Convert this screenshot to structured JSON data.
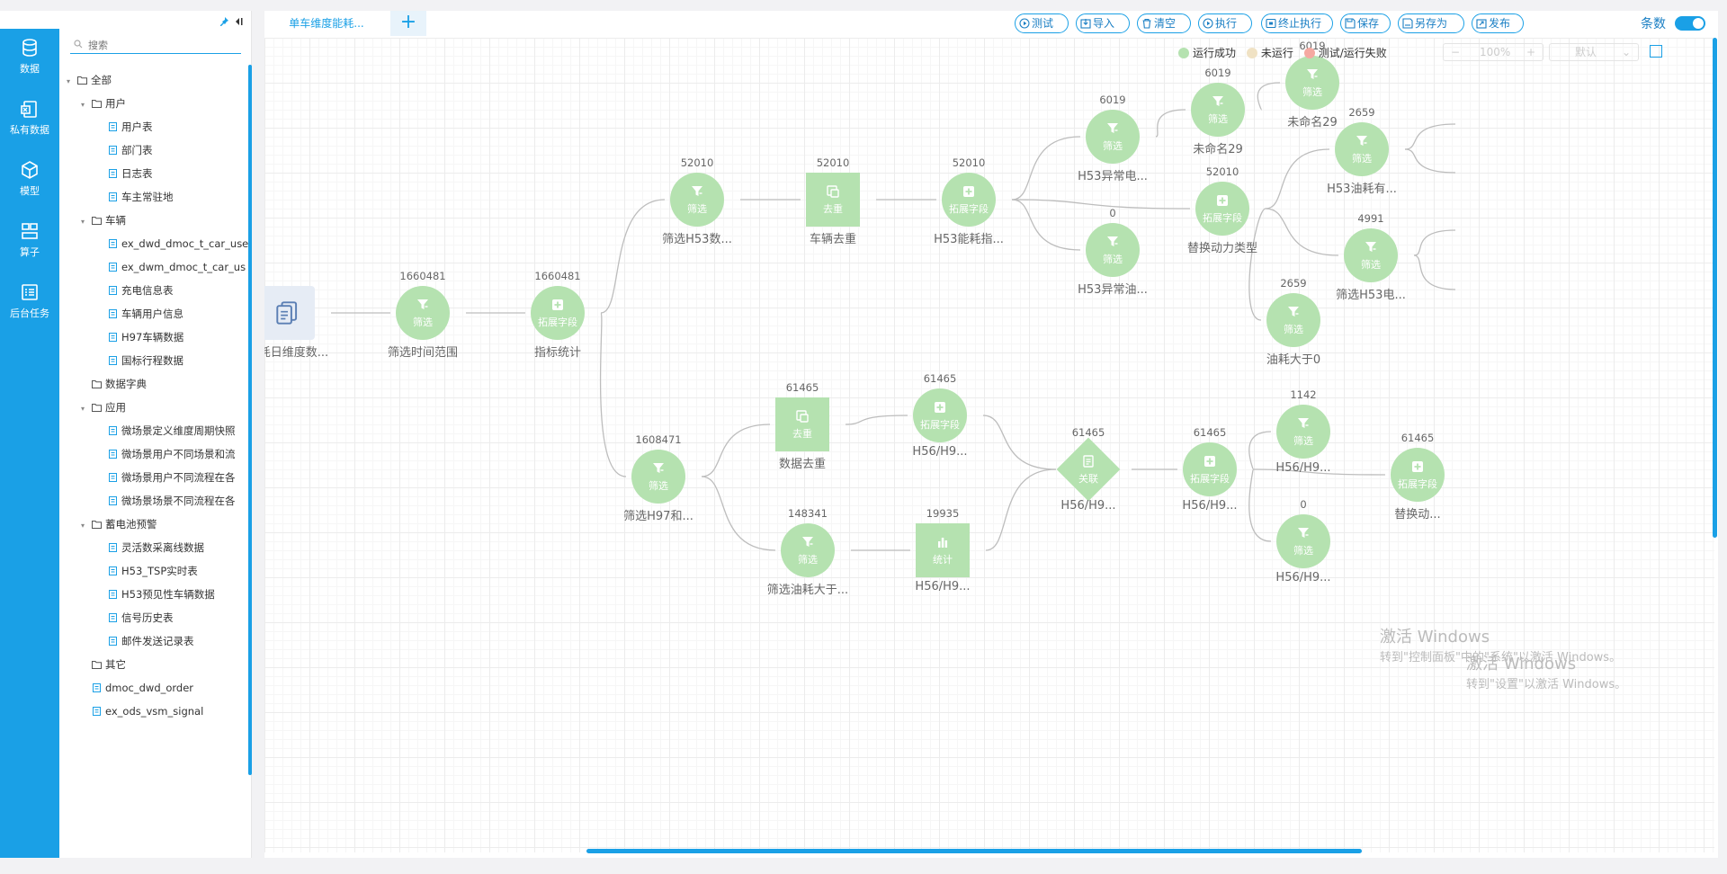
{
  "rail": {
    "items": [
      {
        "label": "数据",
        "icon": "database-icon"
      },
      {
        "label": "私有数据",
        "icon": "private-data-icon"
      },
      {
        "label": "模型",
        "icon": "model-cube-icon"
      },
      {
        "label": "算子",
        "icon": "operator-icon"
      },
      {
        "label": "后台任务",
        "icon": "task-list-icon"
      }
    ]
  },
  "tree": {
    "search_placeholder": "搜索",
    "nodes": [
      {
        "label": "全部",
        "type": "folder",
        "level": 0,
        "expanded": true
      },
      {
        "label": "用户",
        "type": "folder",
        "level": 1,
        "expanded": true
      },
      {
        "label": "用户表",
        "type": "table",
        "level": 2
      },
      {
        "label": "部门表",
        "type": "table",
        "level": 2
      },
      {
        "label": "日志表",
        "type": "table",
        "level": 2
      },
      {
        "label": "车主常驻地",
        "type": "table",
        "level": 2
      },
      {
        "label": "车辆",
        "type": "folder",
        "level": 1,
        "expanded": true
      },
      {
        "label": "ex_dwd_dmoc_t_car_use",
        "type": "table",
        "level": 2
      },
      {
        "label": "ex_dwm_dmoc_t_car_us",
        "type": "table",
        "level": 2
      },
      {
        "label": "充电信息表",
        "type": "table",
        "level": 2
      },
      {
        "label": "车辆用户信息",
        "type": "table",
        "level": 2
      },
      {
        "label": "H97车辆数据",
        "type": "table",
        "level": 2
      },
      {
        "label": "国标行程数据",
        "type": "table",
        "level": 2
      },
      {
        "label": "数据字典",
        "type": "folder",
        "level": 1,
        "expanded": false
      },
      {
        "label": "应用",
        "type": "folder",
        "level": 1,
        "expanded": true
      },
      {
        "label": "微场景定义维度周期快照",
        "type": "table",
        "level": 2
      },
      {
        "label": "微场景用户不同场景和流",
        "type": "table",
        "level": 2
      },
      {
        "label": "微场景用户不同流程在各",
        "type": "table",
        "level": 2
      },
      {
        "label": "微场景场景不同流程在各",
        "type": "table",
        "level": 2
      },
      {
        "label": "蓄电池预警",
        "type": "folder",
        "level": 1,
        "expanded": true
      },
      {
        "label": "灵活数采离线数据",
        "type": "table",
        "level": 2
      },
      {
        "label": "H53_TSP实时表",
        "type": "table",
        "level": 2
      },
      {
        "label": "H53预见性车辆数据",
        "type": "table",
        "level": 2
      },
      {
        "label": "信号历史表",
        "type": "table",
        "level": 2
      },
      {
        "label": "邮件发送记录表",
        "type": "table",
        "level": 2
      },
      {
        "label": "其它",
        "type": "folder",
        "level": 1,
        "expanded": false
      },
      {
        "label": "dmoc_dwd_order",
        "type": "table",
        "level": 1
      },
      {
        "label": "ex_ods_vsm_signal",
        "type": "table",
        "level": 1
      }
    ]
  },
  "tabs": [
    {
      "label": "单车维度能耗..."
    }
  ],
  "toolbar": {
    "buttons": [
      {
        "label": "测试",
        "icon": "play-icon"
      },
      {
        "label": "导入",
        "icon": "import-icon"
      },
      {
        "label": "清空",
        "icon": "trash-icon"
      },
      {
        "label": "执行",
        "icon": "play-icon"
      },
      {
        "label": "终止执行",
        "icon": "stop-icon"
      },
      {
        "label": "保存",
        "icon": "save-icon"
      },
      {
        "label": "另存为",
        "icon": "save-as-icon"
      },
      {
        "label": "发布",
        "icon": "publish-icon"
      }
    ],
    "count_label": "条数",
    "count_toggle_on": true
  },
  "legend": [
    {
      "label": "运行成功",
      "color": "#b5e2b0"
    },
    {
      "label": "未运行",
      "color": "#f0e2c4"
    },
    {
      "label": "测试/运行失败",
      "color": "#f5a9a1"
    }
  ],
  "zoom": {
    "minus": "−",
    "value": "100%",
    "plus": "+"
  },
  "layout_select": "默认",
  "nodes": [
    {
      "id": "n0",
      "kind": "source",
      "op": "",
      "count": "",
      "label": "能耗日维度数..."
    },
    {
      "id": "n1",
      "kind": "filter",
      "op": "筛选",
      "count": "1660481",
      "label": "筛选时间范围"
    },
    {
      "id": "n2",
      "kind": "extend",
      "op": "拓展字段",
      "count": "1660481",
      "label": "指标统计"
    },
    {
      "id": "n3",
      "kind": "filter",
      "op": "筛选",
      "count": "52010",
      "label": "筛选H53数..."
    },
    {
      "id": "n4",
      "kind": "dedup",
      "op": "去重",
      "count": "52010",
      "label": "车辆去重"
    },
    {
      "id": "n5",
      "kind": "extend",
      "op": "拓展字段",
      "count": "52010",
      "label": "H53能耗指..."
    },
    {
      "id": "n6",
      "kind": "filter",
      "op": "筛选",
      "count": "6019",
      "label": "H53异常电..."
    },
    {
      "id": "n7",
      "kind": "filter",
      "op": "筛选",
      "count": "6019",
      "label": "未命名29"
    },
    {
      "id": "n8",
      "kind": "filter",
      "op": "筛选",
      "count": "6019",
      "label": "未命名29"
    },
    {
      "id": "n9",
      "kind": "extend",
      "op": "拓展字段",
      "count": "52010",
      "label": "替换动力类型"
    },
    {
      "id": "n10",
      "kind": "filter",
      "op": "筛选",
      "count": "0",
      "label": "H53异常油..."
    },
    {
      "id": "n11",
      "kind": "filter",
      "op": "筛选",
      "count": "2659",
      "label": "H53油耗有..."
    },
    {
      "id": "n12",
      "kind": "filter",
      "op": "筛选",
      "count": "4991",
      "label": "筛选H53电..."
    },
    {
      "id": "n13",
      "kind": "filter",
      "op": "筛选",
      "count": "2659",
      "label": "油耗大于0"
    },
    {
      "id": "n14",
      "kind": "filter",
      "op": "筛选",
      "count": "1608471",
      "label": "筛选H97和..."
    },
    {
      "id": "n15",
      "kind": "dedup",
      "op": "去重",
      "count": "61465",
      "label": "数据去重"
    },
    {
      "id": "n16",
      "kind": "extend",
      "op": "拓展字段",
      "count": "61465",
      "label": "H56/H9..."
    },
    {
      "id": "n17",
      "kind": "filter",
      "op": "筛选",
      "count": "148341",
      "label": "筛选油耗大于..."
    },
    {
      "id": "n18",
      "kind": "stat",
      "op": "统计",
      "count": "19935",
      "label": "H56/H9..."
    },
    {
      "id": "n19",
      "kind": "join",
      "op": "关联",
      "count": "61465",
      "label": "H56/H9..."
    },
    {
      "id": "n20",
      "kind": "extend",
      "op": "拓展字段",
      "count": "61465",
      "label": "H56/H9..."
    },
    {
      "id": "n21",
      "kind": "filter",
      "op": "筛选",
      "count": "1142",
      "label": "H56/H9..."
    },
    {
      "id": "n22",
      "kind": "filter",
      "op": "筛选",
      "count": "0",
      "label": "H56/H9..."
    },
    {
      "id": "n23",
      "kind": "extend",
      "op": "拓展字段",
      "count": "61465",
      "label": "替换动..."
    }
  ],
  "watermark": {
    "line1": "激活 Windows",
    "line2": "转到\"控制面板\"中的\"系统\"以激活 Windows。",
    "line3": "激活 Windows",
    "line4": "转到\"设置\"以激活 Windows。"
  }
}
